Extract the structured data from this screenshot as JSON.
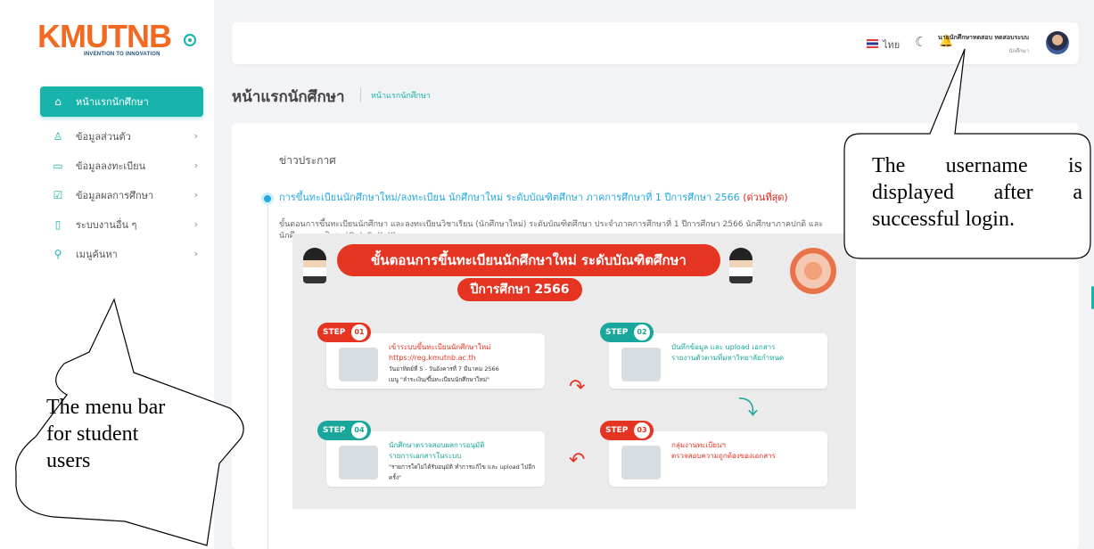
{
  "logo": {
    "brand": "KMUTNB",
    "tagline": "INVENTION TO INNOVATION"
  },
  "sidebar": {
    "items": [
      {
        "label": "หน้าแรกนักศึกษา",
        "icon": "home-icon",
        "active": true
      },
      {
        "label": "ข้อมูลส่วนตัว",
        "icon": "user-icon"
      },
      {
        "label": "ข้อมูลลงทะเบียน",
        "icon": "book-icon"
      },
      {
        "label": "ข้อมูลผลการศึกษา",
        "icon": "check-square-icon"
      },
      {
        "label": "ระบบงานอื่น ๆ",
        "icon": "clipboard-icon"
      },
      {
        "label": "เมนูค้นหา",
        "icon": "search-icon"
      }
    ]
  },
  "topbar": {
    "language": "ไทย",
    "user_name": "นายนักศึกษาทดสอบ ทดสอบระบบ",
    "user_role": "นักศึกษา"
  },
  "page": {
    "title": "หน้าแรกนักศึกษา",
    "breadcrumb": "หน้าแรกนักศึกษา"
  },
  "news": {
    "heading": "ข่าวประกาศ",
    "title": "การขึ้นทะเบียนนักศึกษาใหม่/ลงทะเบียน นักศึกษาใหม่ ระดับบัณฑิตศึกษา ภาคการศึกษาที่ 1 ปีการศึกษา 2566",
    "urgent": "(ด่วนที่สุด)",
    "description": "ขั้นตอนการขึ้นทะเบียนนักศึกษา และลงทะเบียนวิชาเรียน (นักศึกษาใหม่) ระดับบัณฑิตศึกษา ประจำภาคการศึกษาที่ 1 ปีการศึกษา 2566 นักศึกษาภาคปกติ และนักศึกษาภาคพิเศษ (G, I, S, X, Y)"
  },
  "poster": {
    "title": "ขั้นตอนการขึ้นทะเบียนนักศึกษาใหม่ ระดับบัณฑิตศึกษา",
    "year": "ปีการศึกษา 2566",
    "steps": [
      {
        "tag": "STEP",
        "num": "01",
        "text": "เข้าระบบขึ้นทะเบียนนักศึกษาใหม่",
        "link": "https://reg.kmutnb.ac.th",
        "sub1": "วันอาทิตย์ที่ 5 - วันอังคารที่ 7 มีนาคม 2566",
        "sub2": "เมนู \"ลำระเงิน/ขึ้นทะเบียนนักศึกษาใหม่\""
      },
      {
        "tag": "STEP",
        "num": "02",
        "text": "บันทึกข้อมูล และ upload เอกสาร",
        "sub1": "รายงานตัวตามที่มหาวิทยาลัยกำหนด"
      },
      {
        "tag": "STEP",
        "num": "03",
        "text": "กลุ่มงานทะเบียนฯ",
        "sub1": "ตรวจสอบความถูกต้องของเอกสาร"
      },
      {
        "tag": "STEP",
        "num": "04",
        "text": "นักศึกษาตรวจสอบผลการอนุมัติ",
        "sub1": "รายการเอกสารในระบบ",
        "sub2": "\"รายการใดไม่ได้รับอนุมัติ ทำการแก้ไข และ upload ไปอีกครั้ง\""
      }
    ]
  },
  "callouts": {
    "user_lines": [
      "The username is",
      "displayed after a",
      "successful login."
    ],
    "menu_lines": [
      "The menu bar",
      "for student",
      "users"
    ]
  },
  "colors": {
    "accent": "#18b3ab",
    "link": "#25a8e0",
    "urgent": "#e2231a",
    "brand_orange": "#f26a21",
    "brand_navy": "#1f4e79"
  }
}
